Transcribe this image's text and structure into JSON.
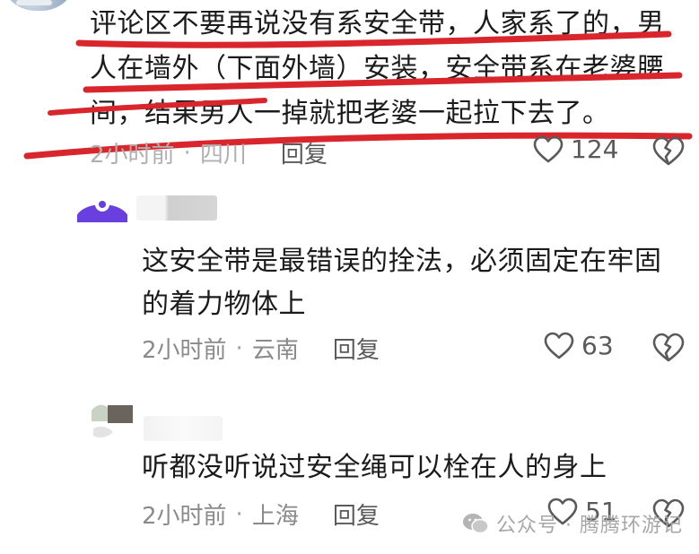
{
  "comment": {
    "text": "评论区不要再说没有系安全带，人家系了的，男人在墙外（下面外墙）安装，安全带系在老婆腰间，结果男人一掉就把老婆一起拉下去了。",
    "time": "2小时前",
    "location": "四川",
    "reply_label": "回复",
    "likes": "124"
  },
  "replies": [
    {
      "text": "这安全带是最错误的拴法，必须固定在牢固的着力物体上",
      "time": "2小时前",
      "location": "云南",
      "reply_label": "回复",
      "likes": "63"
    },
    {
      "text": "听都没听说过安全绳可以栓在人的身上",
      "time": "2小时前",
      "location": "上海",
      "reply_label": "回复",
      "likes": "51"
    }
  ],
  "separator": "·",
  "watermark": {
    "text": "公众号 · 腾腾环游记",
    "icon": "wechat-icon"
  },
  "colors": {
    "annotation_red": "#d8262c",
    "text": "#1b1b1b",
    "meta_gray": "#8a8a8a",
    "reply_gray": "#5a5a5a",
    "avatar_purple": "#6a3fe0"
  }
}
